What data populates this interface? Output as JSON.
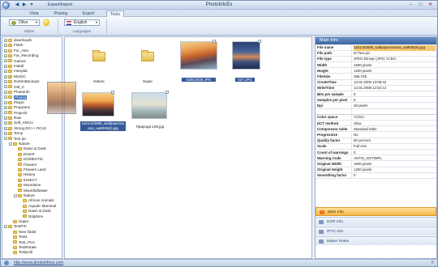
{
  "window": {
    "title": "PhotoInfoEx",
    "min": "‒",
    "max": "□",
    "close": "✕"
  },
  "qat": {
    "back": "◀",
    "forward": "▶",
    "menu": "▾",
    "label": "Export/Import"
  },
  "ribbon": {
    "tabs": [
      {
        "label": "Vista",
        "active": false
      },
      {
        "label": "Posting",
        "active": false
      },
      {
        "label": "Export",
        "active": false
      },
      {
        "label": "Tools",
        "active": true
      }
    ],
    "style_value": "Olive",
    "language_value": "English",
    "group_styles": "Styles",
    "group_languages": "Languages"
  },
  "tree": [
    {
      "label": "downloads",
      "depth": 0,
      "exp": "+"
    },
    {
      "label": "Flash",
      "depth": 0,
      "exp": "+"
    },
    {
      "label": "For_Alex",
      "depth": 0,
      "exp": "+"
    },
    {
      "label": "For_Recording",
      "depth": 0,
      "exp": "+"
    },
    {
      "label": "Games",
      "depth": 0,
      "exp": "+"
    },
    {
      "label": "Install",
      "depth": 0,
      "exp": "+"
    },
    {
      "label": "Interplat",
      "depth": 0,
      "exp": "+"
    },
    {
      "label": "MUSIC",
      "depth": 0,
      "exp": "+"
    },
    {
      "label": "NortonBackups",
      "depth": 0,
      "exp": "+"
    },
    {
      "label": "Old_C",
      "depth": 0,
      "exp": "+"
    },
    {
      "label": "PhotoInfo",
      "depth": 0,
      "exp": "+"
    },
    {
      "label": "Photos",
      "depth": 0,
      "exp": "+",
      "selected": true
    },
    {
      "label": "Player",
      "depth": 0,
      "exp": "+"
    },
    {
      "label": "Programs",
      "depth": 0,
      "exp": "+"
    },
    {
      "label": "Projects",
      "depth": 0,
      "exp": "+"
    },
    {
      "label": "Raw",
      "depth": 0,
      "exp": "+"
    },
    {
      "label": "Soft_ARCH",
      "depth": 0,
      "exp": "+"
    },
    {
      "label": "Strong DC++ RC10",
      "depth": 0,
      "exp": "+"
    },
    {
      "label": "Temp",
      "depth": 0,
      "exp": "+"
    },
    {
      "label": "Test pic",
      "depth": 0,
      "exp": "−"
    },
    {
      "label": "Nature",
      "depth": 1,
      "exp": "−"
    },
    {
      "label": "Dawn & Dusk",
      "depth": 2,
      "exp": ""
    },
    {
      "label": "Desert",
      "depth": 2,
      "exp": ""
    },
    {
      "label": "DOMESTIC",
      "depth": 2,
      "exp": ""
    },
    {
      "label": "Flowers",
      "depth": 2,
      "exp": ""
    },
    {
      "label": "Flowers Land",
      "depth": 2,
      "exp": ""
    },
    {
      "label": "History",
      "depth": 2,
      "exp": ""
    },
    {
      "label": "INSECT",
      "depth": 2,
      "exp": ""
    },
    {
      "label": "Mountains",
      "depth": 2,
      "exp": ""
    },
    {
      "label": "Mountfallwater",
      "depth": 2,
      "exp": ""
    },
    {
      "label": "Nature",
      "depth": 2,
      "exp": "−"
    },
    {
      "label": "African Animals",
      "depth": 3,
      "exp": ""
    },
    {
      "label": "Aquatic Mammal",
      "depth": 3,
      "exp": ""
    },
    {
      "label": "Dawn & Dusk",
      "depth": 3,
      "exp": ""
    },
    {
      "label": "Dolphins",
      "depth": 3,
      "exp": ""
    },
    {
      "label": "Super",
      "depth": 1,
      "exp": ""
    },
    {
      "label": "TestPIC",
      "depth": 0,
      "exp": "−"
    },
    {
      "label": "New folder",
      "depth": 1,
      "exp": ""
    },
    {
      "label": "Test1",
      "depth": 1,
      "exp": ""
    },
    {
      "label": "Test_Pics",
      "depth": 1,
      "exp": ""
    },
    {
      "label": "TestRotate",
      "depth": 1,
      "exp": ""
    },
    {
      "label": "Testproll",
      "depth": 1,
      "exp": ""
    }
  ],
  "thumbs": [
    {
      "name": "folder-nature",
      "type": "folder",
      "caption": "Nature"
    },
    {
      "name": "folder-super",
      "type": "folder",
      "caption": "Super"
    },
    {
      "name": "photo-025c",
      "type": "photo",
      "caption": "025C0025.JPG",
      "highlight": true
    },
    {
      "name": "photo-027",
      "type": "photo",
      "caption": "027.JPG",
      "highlight": true
    },
    {
      "name": "photo-wallpaper",
      "type": "photo",
      "caption": "1161443695_wallpapersm ana_ua9005(6).jpg",
      "highlight": true
    },
    {
      "name": "photo-priroda",
      "type": "photo",
      "caption": "Природа-108.jpg",
      "highlight": false
    }
  ],
  "info": {
    "title": "Main Info",
    "rows": [
      {
        "k": "File name",
        "v": "1161443695_wallpapersmana_ua9005(6).jpg",
        "hl": true
      },
      {
        "k": "File path",
        "v": "D:\\Test pic"
      },
      {
        "k": "File type",
        "v": "JPEG bitmap (JPG) YCbCr"
      },
      {
        "k": "Width",
        "v": "1600 pixels"
      },
      {
        "k": "Height",
        "v": "1200 pixels"
      },
      {
        "k": "FileSize",
        "v": "386,7Kb"
      },
      {
        "k": "CreateTime",
        "v": "13.01.2008 13:09:42"
      },
      {
        "k": "WriteTime",
        "v": "13.01.2008 12:54:12"
      },
      {
        "k": "Bits per sample",
        "v": "8"
      },
      {
        "k": "Samples per pixel",
        "v": "3"
      },
      {
        "k": "Dpi",
        "v": "30 pixels"
      },
      {
        "k": "",
        "v": "",
        "gap": true
      },
      {
        "k": "Color space",
        "v": "YCbCr"
      },
      {
        "k": "DCT method",
        "v": "Slow"
      },
      {
        "k": "Compressor table",
        "v": "Standard table"
      },
      {
        "k": "Progressive",
        "v": "No"
      },
      {
        "k": "Quality factor",
        "v": "80 percent"
      },
      {
        "k": "Scale",
        "v": "Full size"
      },
      {
        "k": "Count of warnings",
        "v": "0"
      },
      {
        "k": "Warning Code",
        "v": "ANTIS_NOTIMPL"
      },
      {
        "k": "Original Width",
        "v": "1600 pixels"
      },
      {
        "k": "Original Height",
        "v": "1200 pixels"
      },
      {
        "k": "Smoothing factor",
        "v": "0"
      }
    ],
    "tabs": [
      {
        "label": "Main Info",
        "active": true
      },
      {
        "label": "EXIF Info",
        "active": false
      },
      {
        "label": "IPTC Info",
        "active": false
      },
      {
        "label": "Maker Notes",
        "active": false
      }
    ]
  },
  "status": {
    "url": "http://www.photoinfoex.com",
    "right": "⠿"
  }
}
